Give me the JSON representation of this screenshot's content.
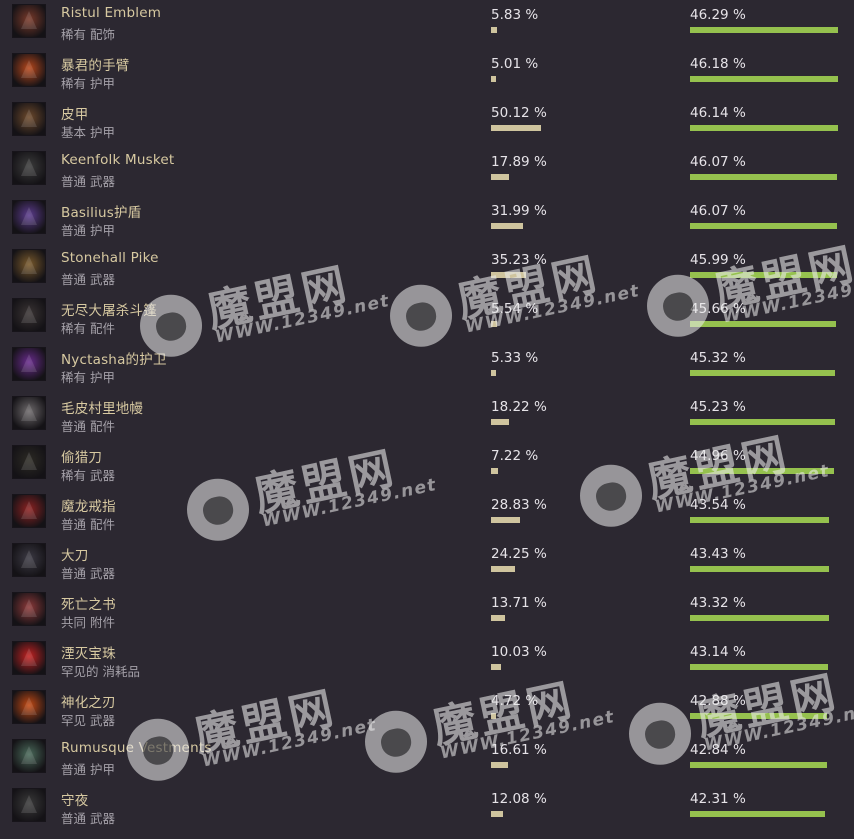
{
  "colors": {
    "background": "#2c2831",
    "name_text": "#d7c9a1",
    "pick_bar": "#cfc49e",
    "win_bar": "#95c14e"
  },
  "items": [
    {
      "name": "Ristul Emblem",
      "rarity": "稀有",
      "type": "配饰",
      "pick_rate": "5.83 %",
      "pick_value": 5.83,
      "win_rate": "46.29 %",
      "win_value": 46.29,
      "icon": "emblem-icon",
      "icon_color": "#7a3a2a"
    },
    {
      "name": "暴君的手臂",
      "rarity": "稀有",
      "type": "护甲",
      "pick_rate": "5.01 %",
      "pick_value": 5.01,
      "win_rate": "46.18 %",
      "win_value": 46.18,
      "icon": "gauntlet-icon",
      "icon_color": "#b8481c"
    },
    {
      "name": "皮甲",
      "rarity": "基本",
      "type": "护甲",
      "pick_rate": "50.12 %",
      "pick_value": 50.12,
      "win_rate": "46.14 %",
      "win_value": 46.14,
      "icon": "leather-armor-icon",
      "icon_color": "#6e4a2c"
    },
    {
      "name": "Keenfolk Musket",
      "rarity": "普通",
      "type": "武器",
      "pick_rate": "17.89 %",
      "pick_value": 17.89,
      "win_rate": "46.07 %",
      "win_value": 46.07,
      "icon": "musket-icon",
      "icon_color": "#3c3c3c"
    },
    {
      "name": "Basilius护盾",
      "rarity": "普通",
      "type": "护甲",
      "pick_rate": "31.99 %",
      "pick_value": 31.99,
      "win_rate": "46.07 %",
      "win_value": 46.07,
      "icon": "crystal-shield-icon",
      "icon_color": "#5c3c8e"
    },
    {
      "name": "Stonehall Pike",
      "rarity": "普通",
      "type": "武器",
      "pick_rate": "35.23 %",
      "pick_value": 35.23,
      "win_rate": "45.99 %",
      "win_value": 45.99,
      "icon": "pike-icon",
      "icon_color": "#7a5a2c"
    },
    {
      "name": "无尽大屠杀斗篷",
      "rarity": "稀有",
      "type": "配件",
      "pick_rate": "5.54 %",
      "pick_value": 5.54,
      "win_rate": "45.66 %",
      "win_value": 45.66,
      "icon": "cloak-icon",
      "icon_color": "#3a3434"
    },
    {
      "name": "Nyctasha的护卫",
      "rarity": "稀有",
      "type": "护甲",
      "pick_rate": "5.33 %",
      "pick_value": 5.33,
      "win_rate": "45.32 %",
      "win_value": 45.32,
      "icon": "purple-guard-icon",
      "icon_color": "#6a2c8e"
    },
    {
      "name": "毛皮村里地幔",
      "rarity": "普通",
      "type": "配件",
      "pick_rate": "18.22 %",
      "pick_value": 18.22,
      "win_rate": "45.23 %",
      "win_value": 45.23,
      "icon": "fur-mantle-icon",
      "icon_color": "#6e6a6c"
    },
    {
      "name": "偷猎刀",
      "rarity": "稀有",
      "type": "武器",
      "pick_rate": "7.22 %",
      "pick_value": 7.22,
      "win_rate": "44.96 %",
      "win_value": 44.96,
      "icon": "hunting-knife-icon",
      "icon_color": "#2c2a24"
    },
    {
      "name": "魔龙戒指",
      "rarity": "普通",
      "type": "配件",
      "pick_rate": "28.83 %",
      "pick_value": 28.83,
      "win_rate": "43.54 %",
      "win_value": 43.54,
      "icon": "dragon-ring-icon",
      "icon_color": "#8e2222"
    },
    {
      "name": "大刀",
      "rarity": "普通",
      "type": "武器",
      "pick_rate": "24.25 %",
      "pick_value": 24.25,
      "win_rate": "43.43 %",
      "win_value": 43.43,
      "icon": "blade-icon",
      "icon_color": "#3c3a44"
    },
    {
      "name": "死亡之书",
      "rarity": "共同",
      "type": "附件",
      "pick_rate": "13.71 %",
      "pick_value": 13.71,
      "win_rate": "43.32 %",
      "win_value": 43.32,
      "icon": "book-icon",
      "icon_color": "#8e3a3a"
    },
    {
      "name": "湮灭宝珠",
      "rarity": "罕见的",
      "type": "消耗品",
      "pick_rate": "10.03 %",
      "pick_value": 10.03,
      "win_rate": "43.14 %",
      "win_value": 43.14,
      "icon": "orb-icon",
      "icon_color": "#c42222"
    },
    {
      "name": "神化之刃",
      "rarity": "罕见",
      "type": "武器",
      "pick_rate": "4.72 %",
      "pick_value": 4.72,
      "win_rate": "42.88 %",
      "win_value": 42.88,
      "icon": "fire-blade-icon",
      "icon_color": "#c44a14"
    },
    {
      "name": "Rumusque Vestments",
      "rarity": "普通",
      "type": "护甲",
      "pick_rate": "16.61 %",
      "pick_value": 16.61,
      "win_rate": "42.84 %",
      "win_value": 42.84,
      "icon": "vestments-icon",
      "icon_color": "#4a6a5a"
    },
    {
      "name": "守夜",
      "rarity": "普通",
      "type": "武器",
      "pick_rate": "12.08 %",
      "pick_value": 12.08,
      "win_rate": "42.31 %",
      "win_value": 42.31,
      "icon": "dagger-icon",
      "icon_color": "#3a3a3a"
    }
  ],
  "watermark": {
    "name": "魔盟网",
    "url": "WWW.12349.net"
  }
}
